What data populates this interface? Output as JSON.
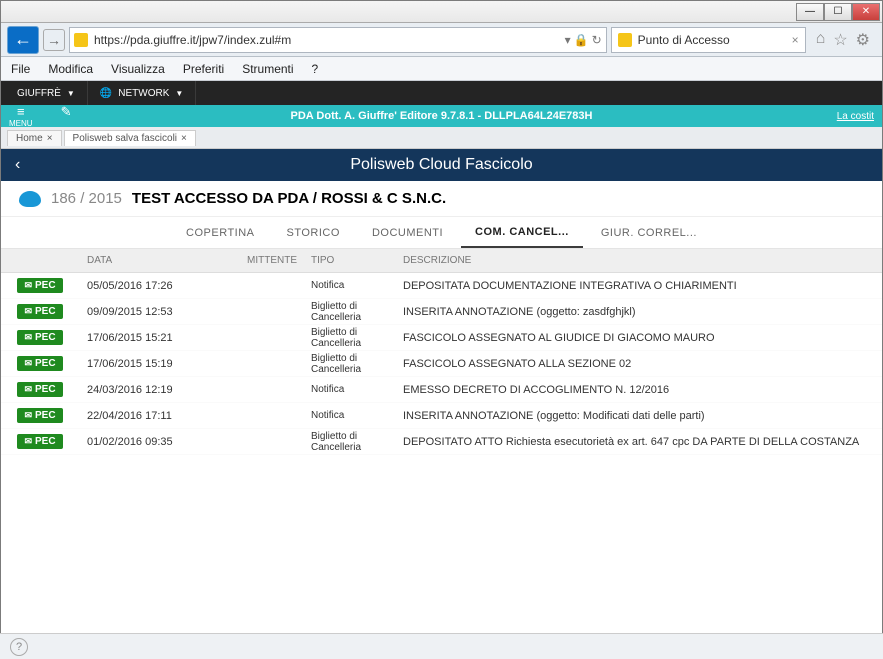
{
  "browser": {
    "url": "https://pda.giuffre.it/jpw7/index.zul#m",
    "tab_title": "Punto di Accesso",
    "menu": [
      "File",
      "Modifica",
      "Visualizza",
      "Preferiti",
      "Strumenti",
      "?"
    ]
  },
  "app_topnav": {
    "btn1": "GIUFFRÈ",
    "btn2": "NETWORK"
  },
  "tealbar": {
    "menu_label": "MENU",
    "center": "PDA Dott. A. Giuffre' Editore 9.7.8.1    -    DLLPLA64L24E783H",
    "right": "La costit"
  },
  "subtabs": {
    "items": [
      {
        "label": "Home"
      },
      {
        "label": "Polisweb salva fascicoli"
      }
    ]
  },
  "page": {
    "title": "Polisweb Cloud Fascicolo",
    "case_number": "186 / 2015",
    "case_title": "TEST ACCESSO DA PDA / ROSSI & C S.N.C."
  },
  "section_tabs": [
    "COPERTINA",
    "STORICO",
    "DOCUMENTI",
    "COM. CANCEL...",
    "GIUR. CORREL..."
  ],
  "section_active_index": 3,
  "table": {
    "headers": {
      "data": "DATA",
      "mittente": "MITTENTE",
      "tipo": "TIPO",
      "descrizione": "DESCRIZIONE"
    },
    "pec_label": "PEC",
    "rows": [
      {
        "data": "05/05/2016 17:26",
        "mittente": "",
        "tipo": "Notifica",
        "descrizione": "DEPOSITATA DOCUMENTAZIONE INTEGRATIVA O CHIARIMENTI"
      },
      {
        "data": "09/09/2015 12:53",
        "mittente": "",
        "tipo": "Biglietto di Cancelleria",
        "descrizione": "INSERITA ANNOTAZIONE (oggetto: zasdfghjkl)"
      },
      {
        "data": "17/06/2015 15:21",
        "mittente": "",
        "tipo": "Biglietto di Cancelleria",
        "descrizione": "FASCICOLO ASSEGNATO AL GIUDICE DI GIACOMO MAURO"
      },
      {
        "data": "17/06/2015 15:19",
        "mittente": "",
        "tipo": "Biglietto di Cancelleria",
        "descrizione": "FASCICOLO ASSEGNATO ALLA SEZIONE 02"
      },
      {
        "data": "24/03/2016 12:19",
        "mittente": "",
        "tipo": "Notifica",
        "descrizione": "EMESSO DECRETO DI ACCOGLIMENTO N. 12/2016"
      },
      {
        "data": "22/04/2016 17:11",
        "mittente": "",
        "tipo": "Notifica",
        "descrizione": "INSERITA ANNOTAZIONE (oggetto: Modificati dati delle parti)"
      },
      {
        "data": "01/02/2016 09:35",
        "mittente": "",
        "tipo": "Biglietto di Cancelleria",
        "descrizione": "DEPOSITATO ATTO Richiesta esecutorietà ex art. 647 cpc DA PARTE DI DELLA COSTANZA"
      }
    ]
  }
}
